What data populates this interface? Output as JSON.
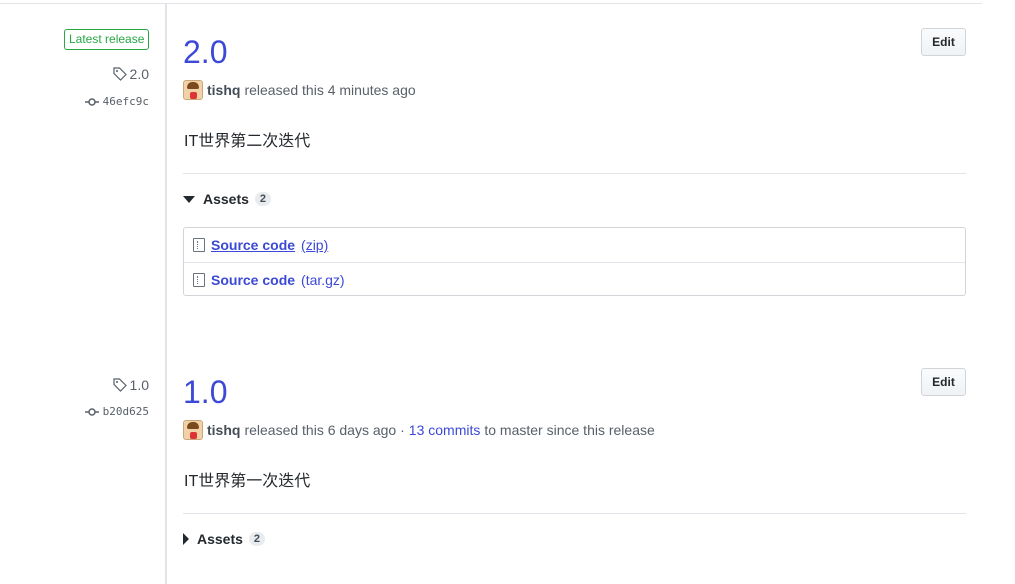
{
  "releases": [
    {
      "badge": "Latest release",
      "tag": "2.0",
      "commit": "46efc9c",
      "title": "2.0",
      "edit_label": "Edit",
      "author": "tishq",
      "released_text": "released this 4 minutes ago",
      "commits_link": "",
      "commits_suffix": "",
      "description": "IT世界第二次迭代",
      "assets_label": "Assets",
      "assets_count": "2",
      "assets_expanded": true,
      "assets": [
        {
          "name": "Source code",
          "ext": "(zip)"
        },
        {
          "name": "Source code",
          "ext": "(tar.gz)"
        }
      ]
    },
    {
      "tag": "1.0",
      "commit": "b20d625",
      "title": "1.0",
      "edit_label": "Edit",
      "author": "tishq",
      "released_text": "released this 6 days ago ·",
      "commits_link": "13 commits",
      "commits_suffix": "to master since this release",
      "description": "IT世界第一次迭代",
      "assets_label": "Assets",
      "assets_count": "2",
      "assets_expanded": false
    }
  ],
  "icons": {
    "tag": "tag-icon",
    "commit": "git-commit-icon",
    "file_zip": "file-zip-icon",
    "caret_down": "triangle-down-icon",
    "caret_right": "triangle-right-icon"
  },
  "colors": {
    "link": "#3b49d6",
    "latest_badge": "#28a745",
    "border": "#e1e4e8"
  }
}
